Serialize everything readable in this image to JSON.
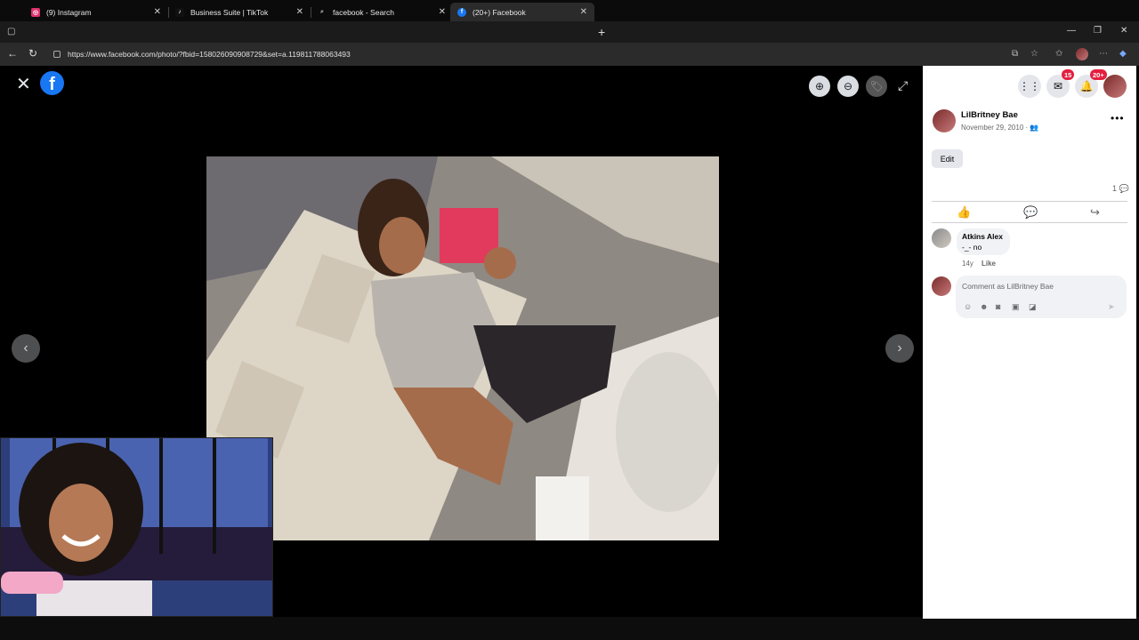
{
  "browser": {
    "tabs": [
      {
        "title": "(9) Instagram",
        "icon": "instagram-icon",
        "color": "#e1306c",
        "active": false
      },
      {
        "title": "Business Suite | TikTok",
        "icon": "tiktok-icon",
        "color": "#111111",
        "active": false
      },
      {
        "title": "facebook - Search",
        "icon": "search-icon",
        "color": "#1b1b1b",
        "active": false
      },
      {
        "title": "(20+) Facebook",
        "icon": "facebook-icon",
        "color": "#1877f2",
        "active": true
      }
    ],
    "new_tab": "+",
    "url": "https://www.facebook.com/photo/?fbid=158026090908729&set=a.119811788063493"
  },
  "viewer": {
    "close": "✕",
    "logo": "f",
    "zoom_in": "⊕",
    "zoom_out": "⊖",
    "tag": "🏷",
    "fullscreen": "⤢",
    "prev": "‹",
    "next": "›"
  },
  "sidebar": {
    "top_icons": {
      "menu_icon": "menu-grid-icon",
      "messenger_badge": "15",
      "notifications_badge": "20+"
    },
    "post": {
      "author": "LilBritney Bae",
      "date": "November 29, 2010 · 👥",
      "more": "•••",
      "edit_label": "Edit",
      "comment_count": "1 💬"
    },
    "actions": {
      "like": "👍",
      "comment": "💬",
      "share": "↪"
    },
    "comments": [
      {
        "name": "Atkins Alex",
        "text": "-_- no",
        "age": "14y",
        "like_label": "Like"
      }
    ],
    "composer": {
      "placeholder": "Comment as LilBritney Bae",
      "tools": [
        "avatar-sticker-icon",
        "emoji-icon",
        "camera-icon",
        "gif-icon",
        "sticker-icon"
      ],
      "send": "➤"
    }
  },
  "colors": {
    "facebook_blue": "#1877f2",
    "badge_red": "#e41e3f"
  }
}
